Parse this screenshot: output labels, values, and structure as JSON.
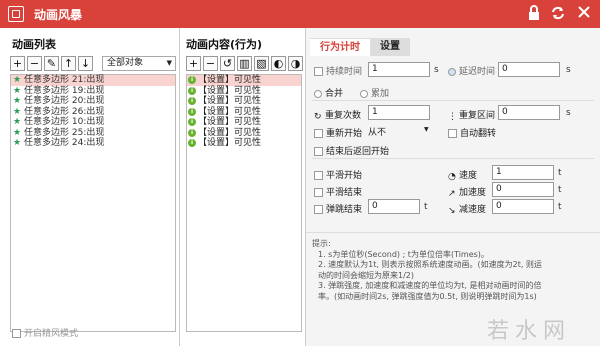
{
  "window": {
    "title": "动画风暴"
  },
  "left": {
    "heading": "动画列表",
    "filter_value": "全部对象",
    "tools": [
      "+",
      "−",
      "✎",
      "↑",
      "↓"
    ],
    "items": [
      {
        "label": "任意多边形 21:出现",
        "selected": true
      },
      {
        "label": "任意多边形 19:出现",
        "selected": false
      },
      {
        "label": "任意多边形 20:出现",
        "selected": false
      },
      {
        "label": "任意多边形 26:出现",
        "selected": false
      },
      {
        "label": "任意多边形 10:出现",
        "selected": false
      },
      {
        "label": "任意多边形 25:出现",
        "selected": false
      },
      {
        "label": "任意多边形 24:出现",
        "selected": false
      }
    ],
    "footer_checkbox": "开启精风模式"
  },
  "mid": {
    "heading": "动画内容(行为)",
    "tools": [
      "+",
      "−",
      "↺",
      "▥",
      "▧",
      "◐",
      "◑"
    ],
    "items": [
      {
        "label": "【设置】可见性",
        "selected": true
      },
      {
        "label": "【设置】可见性",
        "selected": false
      },
      {
        "label": "【设置】可见性",
        "selected": false
      },
      {
        "label": "【设置】可见性",
        "selected": false
      },
      {
        "label": "【设置】可见性",
        "selected": false
      },
      {
        "label": "【设置】可见性",
        "selected": false
      },
      {
        "label": "【设置】可见性",
        "selected": false
      }
    ]
  },
  "right": {
    "tabs": [
      "行为计时",
      "设置"
    ],
    "duration": {
      "label": "持续时间",
      "value": "1",
      "unit": "s"
    },
    "delay": {
      "label": "延迟时间",
      "value": "0",
      "unit": "s"
    },
    "together": "合并",
    "accumulate": "累加",
    "repeat_count": {
      "label": "重复次数",
      "value": "1"
    },
    "repeat_interval": {
      "label": "重复区间",
      "value": "0",
      "unit": "s"
    },
    "restart": {
      "label": "重新开始",
      "value": "从不"
    },
    "auto_reverse": "自动翻转",
    "back_to_start": "结束后返回开始",
    "smooth_start": "平滑开始",
    "smooth_end": "平滑结束",
    "bounce_end": {
      "label": "弹跳结束",
      "value": "0",
      "unit": "t"
    },
    "speed": {
      "label": "速度",
      "value": "1",
      "unit": "t"
    },
    "accel": {
      "label": "加速度",
      "value": "0",
      "unit": "t"
    },
    "decel": {
      "label": "减速度",
      "value": "0",
      "unit": "t"
    },
    "hint_lines": [
      "提示:",
      "1. s为单位秒(Second) ; t为单位倍率(Times)。",
      "2. 速度默认为1t, 则表示按照系统速度动画。(如速度为2t, 则运",
      "动的时间会缩短为原来1/2)",
      "3. 弹跳强度, 加速度和减速度的单位均为t, 是相对动画时间的倍",
      "率。(如动画时间2s, 弹跳强度值为0.5t, 则说明弹跳时间为1s)"
    ]
  },
  "watermark": "若水网"
}
